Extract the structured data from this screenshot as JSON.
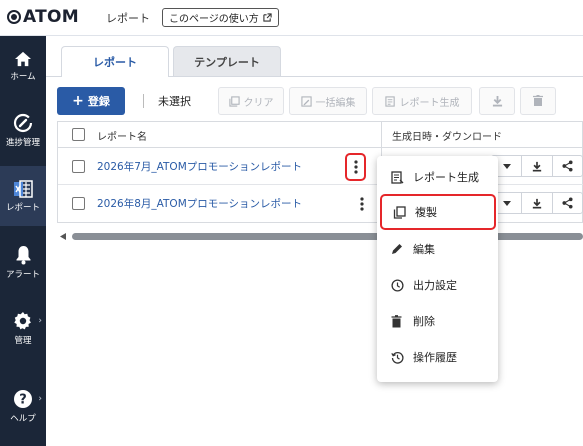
{
  "header": {
    "logo_text": "ATOM",
    "breadcrumb": "レポート",
    "guide_label": "このページの使い方"
  },
  "sidebar": {
    "items": [
      {
        "label": "ホーム",
        "icon": "home-icon"
      },
      {
        "label": "進捗管理",
        "icon": "progress-icon"
      },
      {
        "label": "レポート",
        "icon": "report-icon",
        "active": true
      },
      {
        "label": "アラート",
        "icon": "bell-icon"
      },
      {
        "label": "管理",
        "icon": "gear-icon"
      },
      {
        "label": "ヘルプ",
        "icon": "help-icon"
      }
    ],
    "active_color": "#2c3b57",
    "bg_color": "#1b2638"
  },
  "tabs": [
    {
      "label": "レポート",
      "active": true
    },
    {
      "label": "テンプレート",
      "active": false
    }
  ],
  "toolbar": {
    "register_label": "登録",
    "selection_label": "未選択",
    "clear_label": "クリア",
    "bulk_edit_label": "一括編集",
    "generate_label": "レポート生成",
    "accent_color": "#2a5ba6"
  },
  "table": {
    "columns": [
      "レポート名",
      "生成日時・ダウンロード"
    ],
    "rows": [
      {
        "name": "2026年7月_ATOMプロモーションレポート"
      },
      {
        "name": "2026年8月_ATOMプロモーションレポート"
      }
    ]
  },
  "context_menu": {
    "items": [
      {
        "label": "レポート生成",
        "icon": "report-generate-icon"
      },
      {
        "label": "複製",
        "icon": "copy-icon",
        "highlighted": true
      },
      {
        "label": "編集",
        "icon": "pencil-icon"
      },
      {
        "label": "出力設定",
        "icon": "clock-icon"
      },
      {
        "label": "削除",
        "icon": "trash-icon"
      },
      {
        "label": "操作履歴",
        "icon": "history-icon"
      }
    ],
    "highlight_color": "#e5262a"
  }
}
